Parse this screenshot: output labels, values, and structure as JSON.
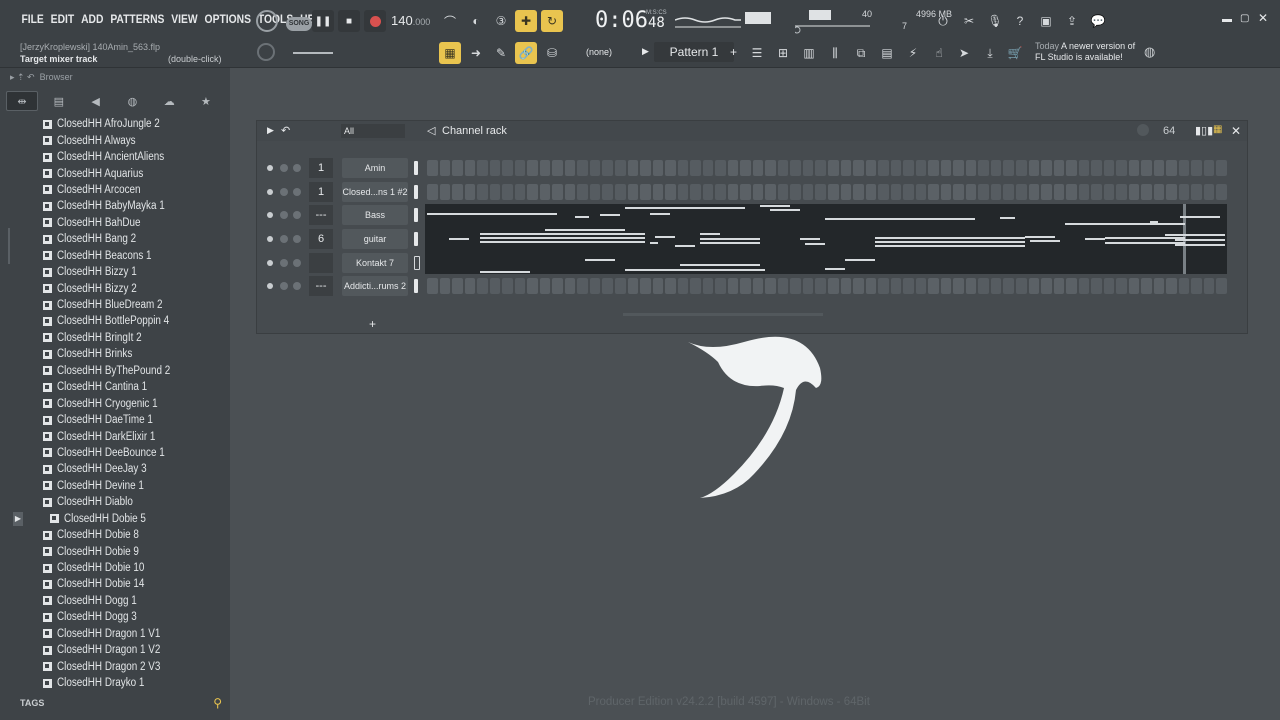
{
  "menu": [
    "FILE",
    "EDIT",
    "ADD",
    "PATTERNS",
    "VIEW",
    "OPTIONS",
    "TOOLS",
    "HELP"
  ],
  "transport": {
    "mode_label": "SONG",
    "bpm": "140",
    "bpm_frac": ".000"
  },
  "clock": {
    "time": "0:06",
    "sub": "48",
    "unit": "M:S:CS"
  },
  "memory": {
    "cpu": "40",
    "ram": "4996 MB",
    "poly": "7"
  },
  "project": {
    "title": "[JerzyKroplewski] 140Amin_563.flp",
    "hint": "Target mixer track",
    "hint_action": "(double-click)"
  },
  "toolbar": {
    "snap": "(none)",
    "pattern": "Pattern 1",
    "pattern_add": "+"
  },
  "news": {
    "date": "Today",
    "line1": "A newer version of",
    "line2": "FL Studio is available!"
  },
  "browser": {
    "header": "Browser",
    "items": [
      "ClosedHH AfroJungle 2",
      "ClosedHH Always",
      "ClosedHH AncientAliens",
      "ClosedHH Aquarius",
      "ClosedHH Arcocen",
      "ClosedHH BabyMayka 1",
      "ClosedHH BahDue",
      "ClosedHH Bang 2",
      "ClosedHH Beacons 1",
      "ClosedHH Bizzy 1",
      "ClosedHH Bizzy 2",
      "ClosedHH BlueDream 2",
      "ClosedHH BottlePoppin 4",
      "ClosedHH BringIt 2",
      "ClosedHH Brinks",
      "ClosedHH ByThePound 2",
      "ClosedHH Cantina 1",
      "ClosedHH Cryogenic 1",
      "ClosedHH DaeTime 1",
      "ClosedHH DarkElixir 1",
      "ClosedHH DeeBounce 1",
      "ClosedHH DeeJay 3",
      "ClosedHH Devine 1",
      "ClosedHH Diablo",
      "ClosedHH Dobie 5",
      "ClosedHH Dobie 8",
      "ClosedHH Dobie 9",
      "ClosedHH Dobie 10",
      "ClosedHH Dobie 14",
      "ClosedHH Dogg 1",
      "ClosedHH Dogg 3",
      "ClosedHH Dragon 1 V1",
      "ClosedHH Dragon 1 V2",
      "ClosedHH Dragon 2 V3",
      "ClosedHH Drayko 1"
    ],
    "tags_label": "TAGS"
  },
  "rack": {
    "title": "Channel rack",
    "filter": "All",
    "steps_label": "64",
    "add_label": "+",
    "channels": [
      {
        "name": "Amin",
        "num": "1"
      },
      {
        "name": "Closed...ns 1 #2",
        "num": "1"
      },
      {
        "name": "Bass",
        "num": "---"
      },
      {
        "name": "guitar",
        "num": "6"
      },
      {
        "name": "Kontakt 7",
        "num": ""
      },
      {
        "name": "Addicti...rums 2",
        "num": "---"
      }
    ]
  },
  "footer": "Producer Edition v24.2.2 [build 4597] - Windows - 64Bit"
}
